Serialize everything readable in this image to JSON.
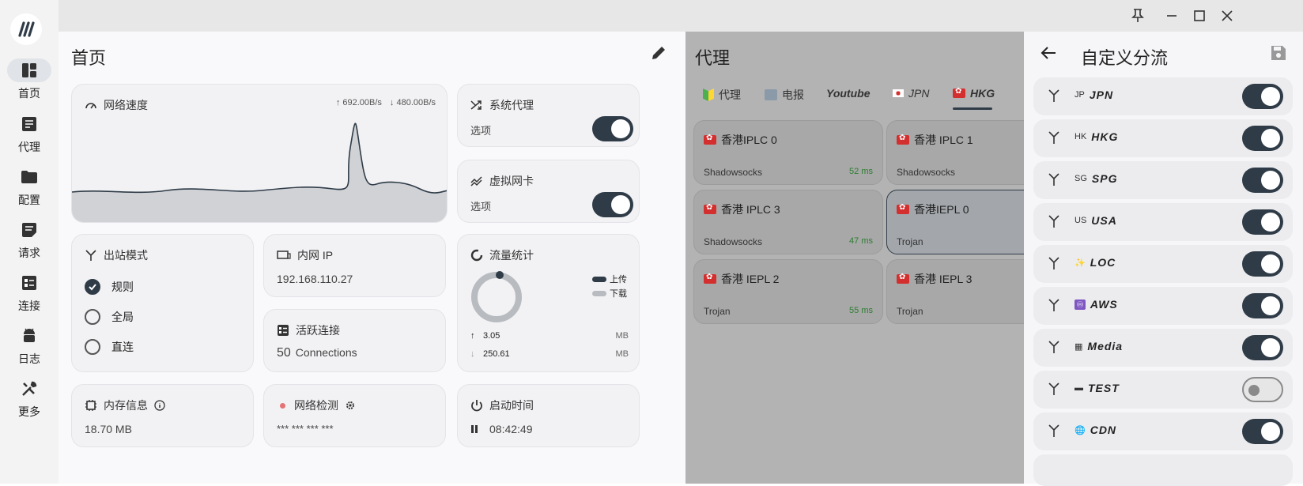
{
  "window": {
    "pin_icon": "pin-icon",
    "minimize_icon": "minimize-icon",
    "maximize_icon": "maximize-icon",
    "close_icon": "close-icon"
  },
  "sidebar": {
    "items": [
      {
        "label": "首页",
        "icon": "dashboard-icon",
        "active": true
      },
      {
        "label": "代理",
        "icon": "article-icon"
      },
      {
        "label": "配置",
        "icon": "folder-icon"
      },
      {
        "label": "请求",
        "icon": "notes-icon"
      },
      {
        "label": "连接",
        "icon": "list-icon"
      },
      {
        "label": "日志",
        "icon": "android-icon"
      },
      {
        "label": "更多",
        "icon": "tools-icon"
      }
    ]
  },
  "home": {
    "title": "首页",
    "speed": {
      "title": "网络速度",
      "up": "↑ 692.00B/s",
      "down": "↓ 480.00B/s"
    },
    "system_proxy": {
      "title": "系统代理",
      "option": "选项",
      "on": true
    },
    "tun": {
      "title": "虚拟网卡",
      "option": "选项",
      "on": true
    },
    "outbound": {
      "title": "出站模式",
      "options": [
        "规则",
        "全局",
        "直连"
      ],
      "selected": 0
    },
    "lan_ip": {
      "title": "内网 IP",
      "value": "192.168.110.27"
    },
    "active_conn": {
      "title": "活跃连接",
      "count": "50",
      "unit": "Connections"
    },
    "traffic": {
      "title": "流量统计",
      "legend_up": "上传",
      "legend_down": "下载",
      "up_value": "3.05",
      "up_unit": "MB",
      "down_value": "250.61",
      "down_unit": "MB"
    },
    "memory": {
      "title": "内存信息",
      "value": "18.70  MB"
    },
    "net_check": {
      "title": "网络检测",
      "value": "*** *** *** ***"
    },
    "uptime": {
      "title": "启动时间",
      "value": "08:42:49"
    }
  },
  "proxy": {
    "title": "代理",
    "tabs": [
      {
        "label": "代理",
        "icon": "beginner-icon"
      },
      {
        "label": "电报",
        "icon": "newspaper-icon"
      },
      {
        "label": "Youtube",
        "icon": ""
      },
      {
        "label": "JPN",
        "icon": "jp-flag-icon"
      },
      {
        "label": "HKG",
        "icon": "hk-flag-icon",
        "selected": true
      }
    ],
    "nodes": [
      {
        "name": "香港IPLC  0",
        "type": "Shadowsocks",
        "latency": "52 ms"
      },
      {
        "name": "香港 IPLC  1",
        "type": "Shadowsocks",
        "latency": ""
      },
      {
        "name": "香港 IPLC  3",
        "type": "Shadowsocks",
        "latency": "47 ms"
      },
      {
        "name": "香港IEPL  0",
        "type": "Trojan",
        "latency": "",
        "selected": true
      },
      {
        "name": "香港 IEPL  2",
        "type": "Trojan",
        "latency": "55 ms"
      },
      {
        "name": "香港 IEPL  3",
        "type": "Trojan",
        "latency": ""
      }
    ]
  },
  "drawer": {
    "title": "自定义分流",
    "back_icon": "arrow-back-icon",
    "save_icon": "save-icon",
    "rules": [
      {
        "code": "JP",
        "name": "JPN",
        "on": true
      },
      {
        "code": "HK",
        "name": "HKG",
        "on": true
      },
      {
        "code": "SG",
        "name": "SPG",
        "on": true
      },
      {
        "code": "US",
        "name": "USA",
        "on": true
      },
      {
        "code": "✨",
        "name": "LOC",
        "on": true
      },
      {
        "code": "♾",
        "name": "AWS",
        "on": true
      },
      {
        "code": "▦",
        "name": "Media",
        "on": true
      },
      {
        "code": "▬",
        "name": "TEST",
        "on": false
      },
      {
        "code": "🌐",
        "name": "CDN",
        "on": true
      }
    ]
  },
  "colors": {
    "accent": "#2f3c48",
    "latency": "#2e7d32",
    "flag": "#d32f2f",
    "status_dot": "#e57373"
  }
}
